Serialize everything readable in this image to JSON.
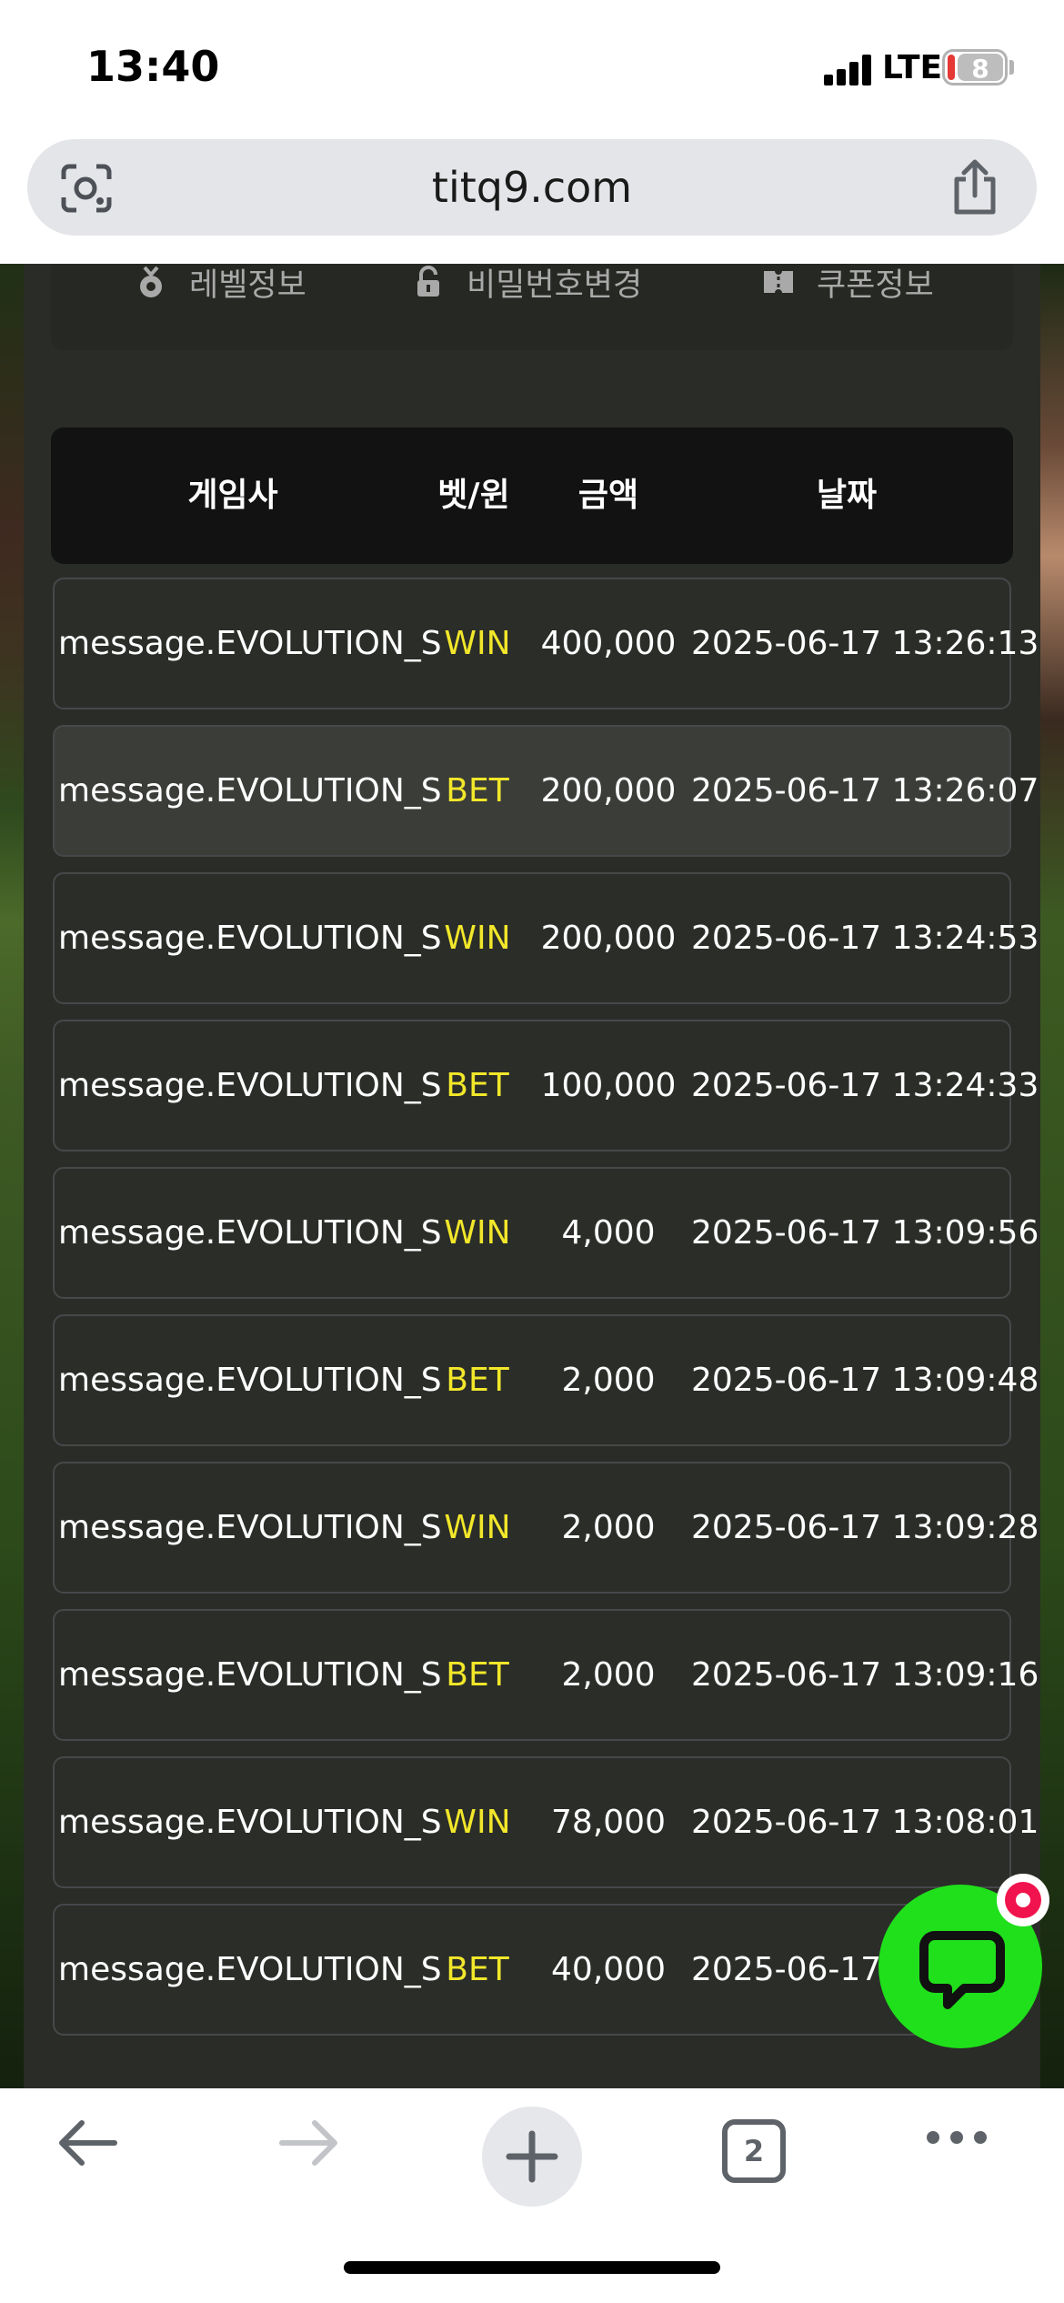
{
  "status_bar": {
    "time": "13:40",
    "network": "LTE",
    "battery": "8"
  },
  "browser": {
    "url": "titq9.com",
    "tab_count": "2"
  },
  "menu": [
    {
      "label": "레벨정보",
      "icon": "medal-icon"
    },
    {
      "label": "비밀번호변경",
      "icon": "lock-icon"
    },
    {
      "label": "쿠폰정보",
      "icon": "ticket-icon"
    }
  ],
  "table": {
    "headers": {
      "game": "게임사",
      "type": "벳/윈",
      "amount": "금액",
      "date": "날짜"
    },
    "rows": [
      {
        "game": "message.EVOLUTION_S",
        "type": "WIN",
        "amount": "400,000",
        "date": "2025-06-17 13:26:13"
      },
      {
        "game": "message.EVOLUTION_S",
        "type": "BET",
        "amount": "200,000",
        "date": "2025-06-17 13:26:07"
      },
      {
        "game": "message.EVOLUTION_S",
        "type": "WIN",
        "amount": "200,000",
        "date": "2025-06-17 13:24:53"
      },
      {
        "game": "message.EVOLUTION_S",
        "type": "BET",
        "amount": "100,000",
        "date": "2025-06-17 13:24:33"
      },
      {
        "game": "message.EVOLUTION_S",
        "type": "WIN",
        "amount": "4,000",
        "date": "2025-06-17 13:09:56"
      },
      {
        "game": "message.EVOLUTION_S",
        "type": "BET",
        "amount": "2,000",
        "date": "2025-06-17 13:09:48"
      },
      {
        "game": "message.EVOLUTION_S",
        "type": "WIN",
        "amount": "2,000",
        "date": "2025-06-17 13:09:28"
      },
      {
        "game": "message.EVOLUTION_S",
        "type": "BET",
        "amount": "2,000",
        "date": "2025-06-17 13:09:16"
      },
      {
        "game": "message.EVOLUTION_S",
        "type": "WIN",
        "amount": "78,000",
        "date": "2025-06-17 13:08:01"
      },
      {
        "game": "message.EVOLUTION_S",
        "type": "BET",
        "amount": "40,000",
        "date": "2025-06-17 13:07:52"
      }
    ]
  },
  "colors": {
    "win_bet_text": "#f2e72a",
    "chat_button": "#1fe01b",
    "badge": "#f0134d"
  }
}
